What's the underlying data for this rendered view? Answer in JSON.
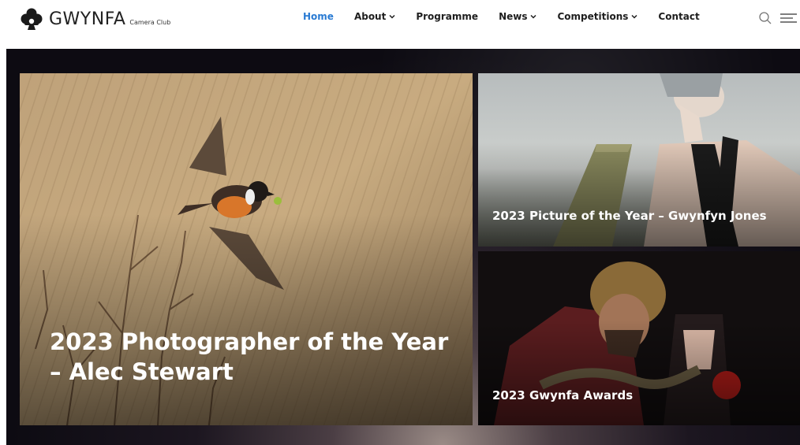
{
  "brand": {
    "name": "GWYNFA",
    "subtitle": "Camera Club",
    "logo_icon": "club-suit-camera-icon"
  },
  "nav": {
    "items": [
      {
        "label": "Home",
        "active": true,
        "dropdown": false
      },
      {
        "label": "About",
        "active": false,
        "dropdown": true
      },
      {
        "label": "Programme",
        "active": false,
        "dropdown": false
      },
      {
        "label": "News",
        "active": false,
        "dropdown": true
      },
      {
        "label": "Competitions",
        "active": false,
        "dropdown": true
      },
      {
        "label": "Contact",
        "active": false,
        "dropdown": false
      }
    ],
    "active_color": "#2a7bd3"
  },
  "tools": {
    "search_icon": "search-icon",
    "menu_icon": "menu-icon"
  },
  "hero": {
    "main": {
      "title": "2023 Photographer of the Year – Alec Stewart"
    },
    "top_right": {
      "title": "2023 Picture of the Year – Gwynfyn Jones"
    },
    "bottom_right": {
      "title": "2023 Gwynfa Awards"
    }
  }
}
